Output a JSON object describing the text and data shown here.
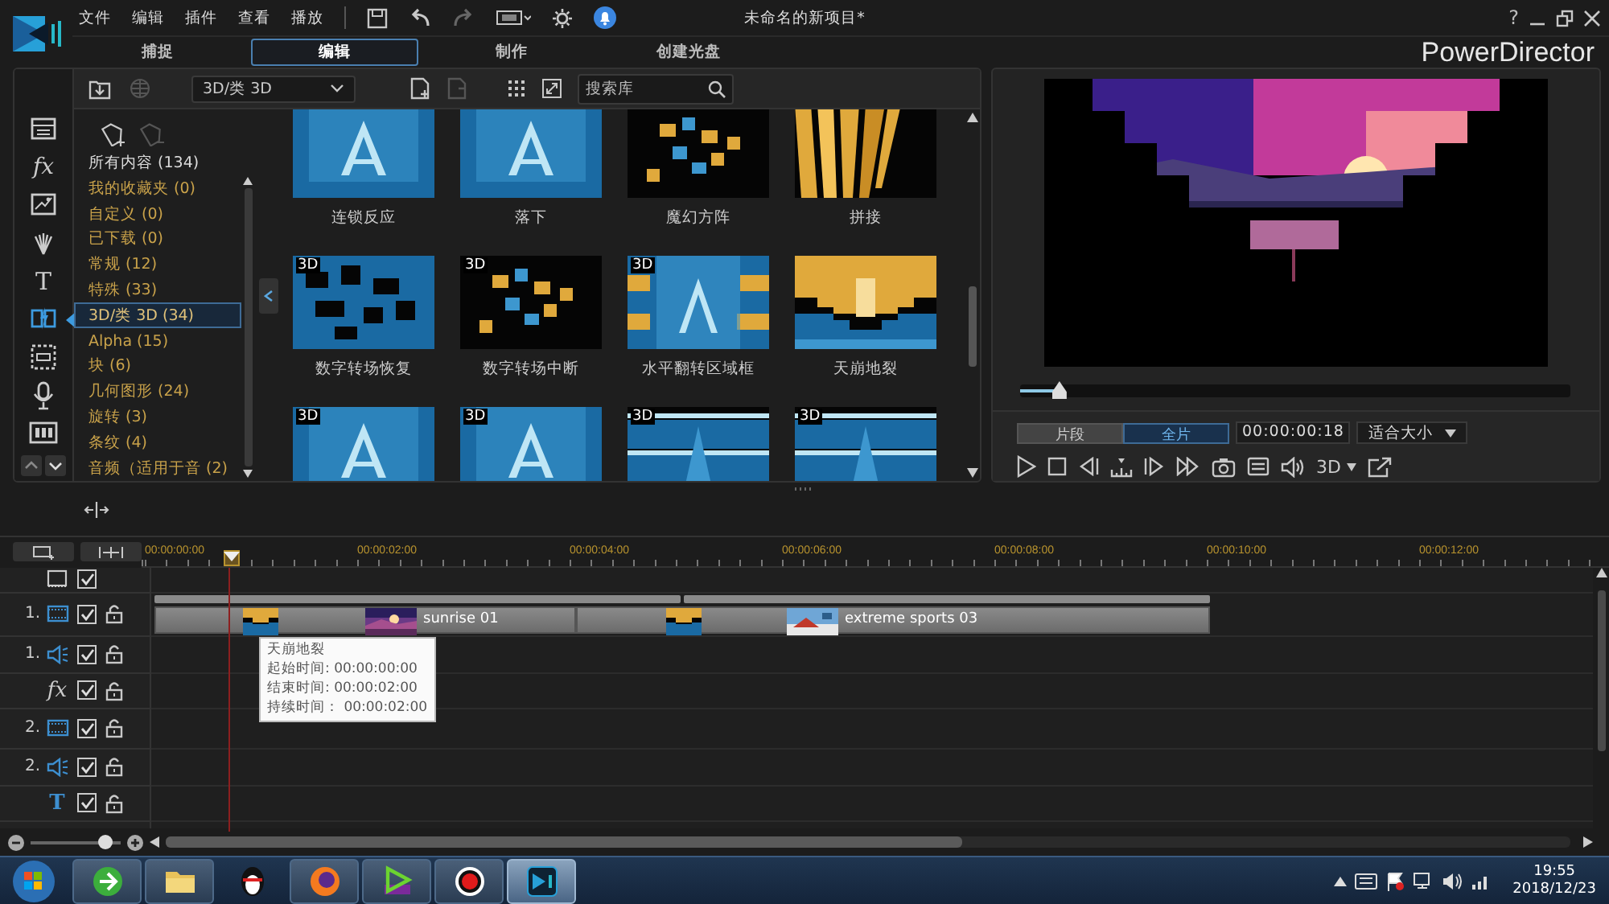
{
  "app": {
    "menu": [
      "文件",
      "编辑",
      "插件",
      "查看",
      "播放"
    ],
    "title": "未命名的新项目*",
    "help": "?",
    "brand": "PowerDirector"
  },
  "tabs": [
    {
      "label": "捕捉",
      "selected": false
    },
    {
      "label": "编辑",
      "selected": true
    },
    {
      "label": "制作",
      "selected": false
    },
    {
      "label": "创建光盘",
      "selected": false
    }
  ],
  "rail": [
    {
      "selected": false
    },
    {
      "label": "fx",
      "selected": false
    },
    {
      "selected": false
    },
    {
      "selected": false
    },
    {
      "label": "T",
      "selected": false
    },
    {
      "selected": true
    },
    {
      "selected": false
    },
    {
      "selected": false
    },
    {
      "selected": false
    }
  ],
  "library": {
    "filter": "3D/类 3D",
    "search": {
      "placeholder": "搜索库"
    },
    "categories": [
      {
        "kind": "all",
        "label": "所有内容",
        "count": "(134)",
        "selected": false
      },
      {
        "kind": "category",
        "label": "我的收藏夹",
        "count": "(0)",
        "selected": false
      },
      {
        "kind": "category",
        "label": "自定义",
        "count": "(0)",
        "selected": false
      },
      {
        "kind": "category",
        "label": "已下载",
        "count": "(0)",
        "selected": false
      },
      {
        "kind": "category",
        "label": "常规",
        "count": "(12)",
        "selected": false
      },
      {
        "kind": "category",
        "label": "特殊",
        "count": "(33)",
        "selected": false
      },
      {
        "kind": "category",
        "label": "3D/类 3D",
        "count": "(34)",
        "selected": true
      },
      {
        "kind": "category",
        "label": "Alpha",
        "count": "(15)",
        "selected": false
      },
      {
        "kind": "category",
        "label": "块",
        "count": "(6)",
        "selected": false
      },
      {
        "kind": "category",
        "label": "几何图形",
        "count": "(24)",
        "selected": false
      },
      {
        "kind": "category",
        "label": "旋转",
        "count": "(3)",
        "selected": false
      },
      {
        "kind": "category",
        "label": "条纹",
        "count": "(4)",
        "selected": false
      },
      {
        "kind": "category",
        "label": "音频（适用于音",
        "count": "(2)",
        "selected": false
      }
    ],
    "items": [
      {
        "label": "连锁反应"
      },
      {
        "label": "落下"
      },
      {
        "label": "魔幻方阵"
      },
      {
        "label": "拼接"
      },
      {
        "badge": "3D",
        "label": "数字转场恢复"
      },
      {
        "badge": "3D",
        "label": "数字转场中断"
      },
      {
        "badge": "3D",
        "label": "水平翻转区域框"
      },
      {
        "label": "天崩地裂"
      },
      {
        "badge": "3D"
      },
      {
        "badge": "3D"
      },
      {
        "badge": "3D"
      },
      {
        "badge": "3D"
      }
    ]
  },
  "preview": {
    "level": 0.07,
    "modes": [
      {
        "label": "片段",
        "selected": false
      },
      {
        "label": "全片",
        "selected": true
      }
    ],
    "timecode": "00:00:00:18",
    "fit": "适合大小",
    "stereo": "3D"
  },
  "timeline": {
    "ruler": [
      "00:00:00:00",
      "00:00:02:00",
      "00:00:04:00",
      "00:00:06:00",
      "00:00:08:00",
      "00:00:10:00",
      "00:00:12:00"
    ],
    "tracks": [
      {
        "checked": true
      },
      {
        "number": "1.",
        "checked": true,
        "locked": false
      },
      {
        "number": "1.",
        "checked": true,
        "locked": false
      },
      {
        "label": "fx",
        "checked": true,
        "locked": false
      },
      {
        "number": "2.",
        "checked": true,
        "locked": false
      },
      {
        "number": "2.",
        "checked": true,
        "locked": false
      },
      {
        "label": "T",
        "checked": true,
        "locked": false
      }
    ],
    "clips": [
      {
        "label": "sunrise 01"
      },
      {
        "label": "extreme sports 03"
      }
    ],
    "tooltip": {
      "title": "天崩地裂",
      "lines": [
        "起始时间: 00:00:00:00",
        "结束时间: 00:00:02:00",
        "持续时间： 00:00:02:00"
      ]
    },
    "zoom": {
      "level": 0.83
    }
  },
  "taskbar": {
    "apps": [
      {
        "selected": false
      },
      {
        "selected": false
      },
      {
        "selected": false
      },
      {
        "selected": false
      },
      {
        "selected": false
      },
      {
        "selected": false
      },
      {
        "selected": true
      }
    ],
    "clock": {
      "time": "19:55",
      "date": "2018/12/23"
    }
  }
}
